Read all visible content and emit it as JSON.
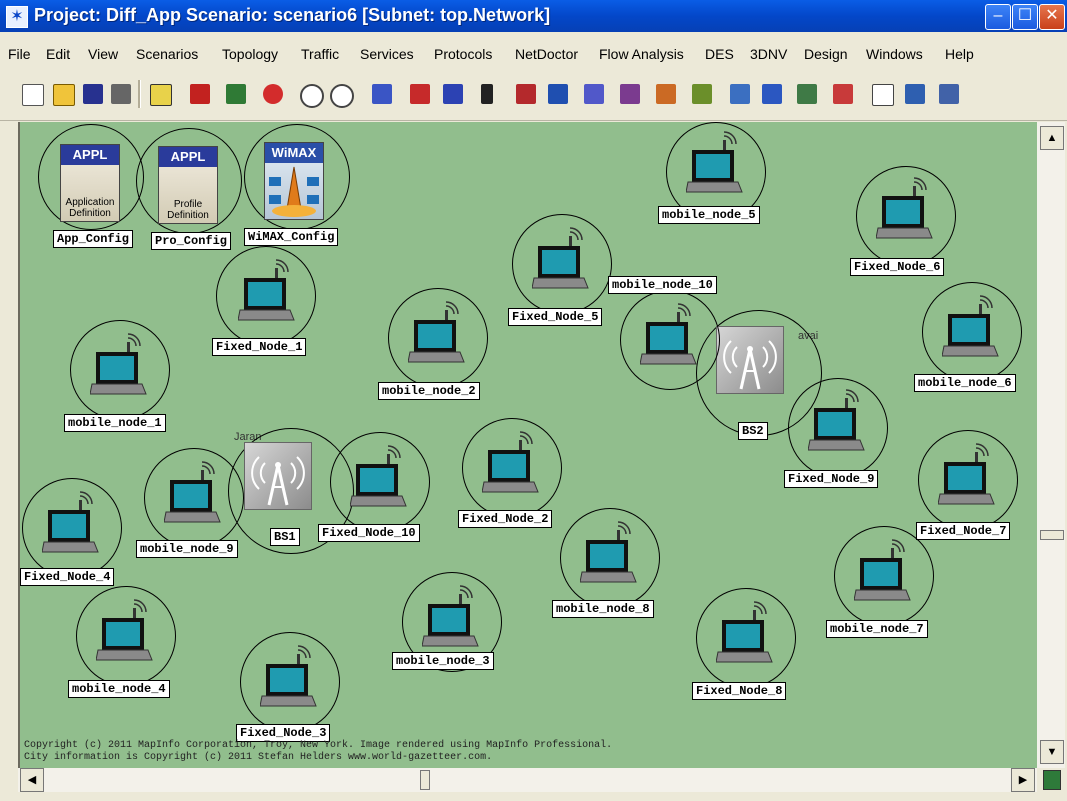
{
  "window": {
    "title": "Project: Diff_App Scenario: scenario6  [Subnet: top.Network]",
    "minimize_glyph": "‒",
    "maximize_glyph": "☐",
    "close_glyph": "✕"
  },
  "menu": [
    "File",
    "Edit",
    "View",
    "Scenarios",
    "Topology",
    "Traffic",
    "Services",
    "Protocols",
    "NetDoctor",
    "Flow Analysis",
    "DES",
    "3DNV",
    "Design",
    "Windows",
    "Help"
  ],
  "config_objects": {
    "app": {
      "header": "APPL",
      "caption": "Application Definition",
      "label": "App_Config"
    },
    "profile": {
      "header": "APPL",
      "caption": "Profile Definition",
      "label": "Pro_Config"
    },
    "wimax": {
      "header": "WiMAX",
      "label": "WiMAX_Config"
    }
  },
  "nodes": [
    "Fixed_Node_1",
    "mobile_node_1",
    "mobile_node_2",
    "Fixed_Node_5",
    "mobile_node_10",
    "mobile_node_5",
    "Fixed_Node_6",
    "mobile_node_6",
    "Fixed_Node_9",
    "Fixed_Node_7",
    "mobile_node_7",
    "Fixed_Node_8",
    "mobile_node_8",
    "Fixed_Node_2",
    "mobile_node_3",
    "Fixed_Node_10",
    "mobile_node_9",
    "Fixed_Node_4",
    "mobile_node_4",
    "Fixed_Node_3"
  ],
  "base_stations": {
    "bs1": "BS1",
    "bs2": "BS2"
  },
  "faint_labels": {
    "bs1": "Jaran",
    "bs2": "avai"
  },
  "copyright": {
    "line1": "Copyright (c) 2011 MapInfo Corporation, Troy, New York. Image rendered using MapInfo Professional.",
    "line2": "City information is Copyright (c) 2011 Stefan Helders www.world-gazetteer.com."
  },
  "scroll": {
    "up": "▲",
    "down": "▼",
    "left": "◀",
    "right": "▶"
  },
  "colors": {
    "map_bg": "#91be8d",
    "title_bar": "#0a5de6",
    "laptop_screen": "#1f9bb0"
  }
}
